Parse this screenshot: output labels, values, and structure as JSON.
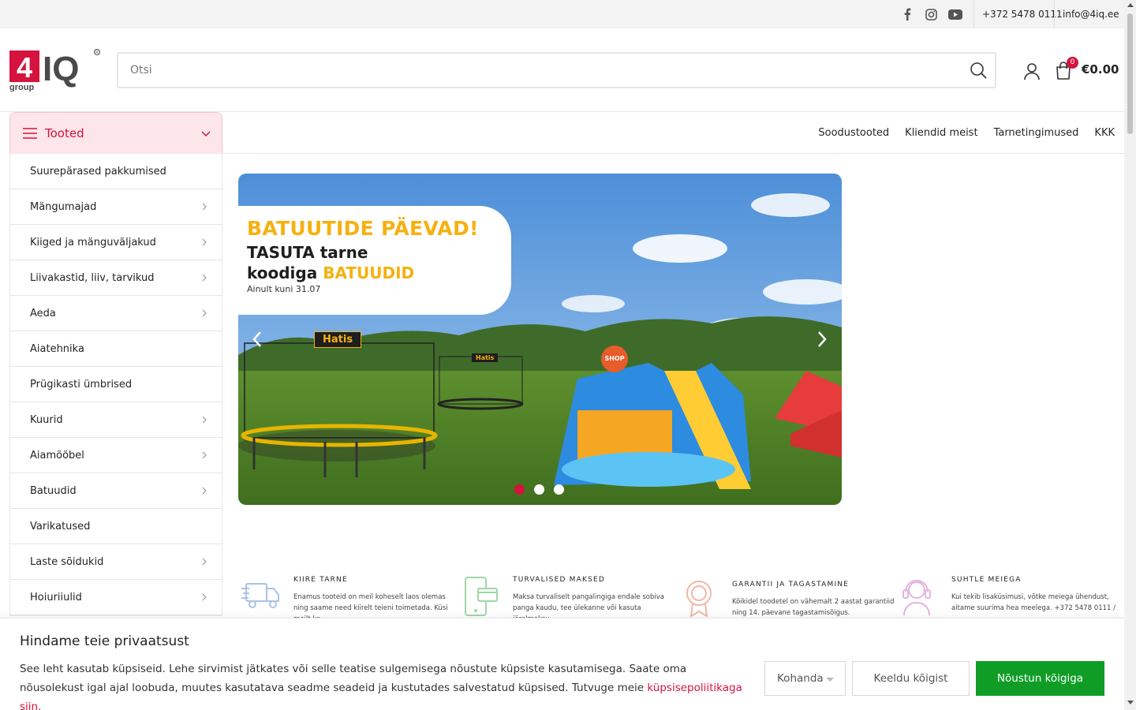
{
  "topbar": {
    "social_icons": [
      "facebook-icon",
      "instagram-icon",
      "youtube-icon"
    ],
    "phone": "+372 5478 0111",
    "email": "info@4iq.ee"
  },
  "header": {
    "logo_text": "4IQ",
    "logo_sub": "group",
    "search_placeholder": "Otsi",
    "cart_count": "0",
    "cart_total": "€0.00"
  },
  "nav": {
    "categories_label": "Tooted",
    "links": [
      "Soodustooted",
      "Kliendid meist",
      "Tarnetingimused",
      "KKK"
    ]
  },
  "categories": [
    {
      "label": "Suurepärased pakkumised",
      "sub": false
    },
    {
      "label": "Mängumajad",
      "sub": true
    },
    {
      "label": "Kiiged ja mänguväljakud",
      "sub": true
    },
    {
      "label": "Liivakastid, liiv, tarvikud",
      "sub": true
    },
    {
      "label": "Aeda",
      "sub": true
    },
    {
      "label": "Aiatehnika",
      "sub": false
    },
    {
      "label": "Prügikasti ümbrised",
      "sub": false
    },
    {
      "label": "Kuurid",
      "sub": true
    },
    {
      "label": "Aiamööbel",
      "sub": true
    },
    {
      "label": "Batuudid",
      "sub": true
    },
    {
      "label": "Varikatused",
      "sub": false
    },
    {
      "label": "Laste sõidukid",
      "sub": true
    },
    {
      "label": "Hoiuriiulid",
      "sub": true
    }
  ],
  "slider": {
    "headline": "BATUUTIDE PÄEVAD!",
    "line2": "TASUTA tarne",
    "line3_prefix": "koodiga ",
    "line3_code": "BATUUDID",
    "note": "Ainult kuni 31.07",
    "brand1": "Hatis",
    "brand2": "Hatis",
    "shop_sign": "SHOP",
    "active_slide": 1,
    "slide_count": 3
  },
  "features": [
    {
      "icon": "delivery-truck-icon",
      "title": "KIIRE  TARNE",
      "text": "Enamus tooteid on meil koheselt laos olemas ning saame need kiirelt teieni toimetada. Küsi meilt ka",
      "color": "#a9c4e6"
    },
    {
      "icon": "secure-payment-icon",
      "title": "TURVALISED  MAKSED",
      "text": "Maksa turvaliselt pangalingiga endale sobiva panga kaudu, tee ülekanne või kasuta järelmaksu",
      "color": "#9fd6a4"
    },
    {
      "icon": "warranty-badge-icon",
      "title": "GARANTII  JA  TAGASTAMINE",
      "text": "Kõikidel toodetel on vähemalt 2 aastat garantiid ning 14. päevane tagastamisõigus.",
      "color": "#f2b8a8"
    },
    {
      "icon": "support-headset-icon",
      "title": "SUHTLE  MEIEGA",
      "text": "Kui tekib lisaküsimusi, võtke meiega ühendust, aitame suurima hea meelega. +372 5478 0111 /",
      "color": "#e4b4e0"
    }
  ],
  "cookie": {
    "title": "Hindame teie privaatsust",
    "text": "See leht kasutab küpsiseid. Lehe sirvimist jätkates või selle teatise sulgemisega nõustute küpsiste kasutamisega. Saate oma nõusolekust igal ajal loobuda, muutes kasutatava seadme seadeid ja kustutades salvestatud küpsised. Tutvuge meie ",
    "link": "küpsisepoliitikaga siin.",
    "customize": "Kohanda",
    "reject": "Keeldu kõigist",
    "accept": "Nõustun kõigiga"
  },
  "colors": {
    "accent": "#d6123e",
    "accept_green": "#0f9d26",
    "promo_yellow": "#f6b10f"
  }
}
